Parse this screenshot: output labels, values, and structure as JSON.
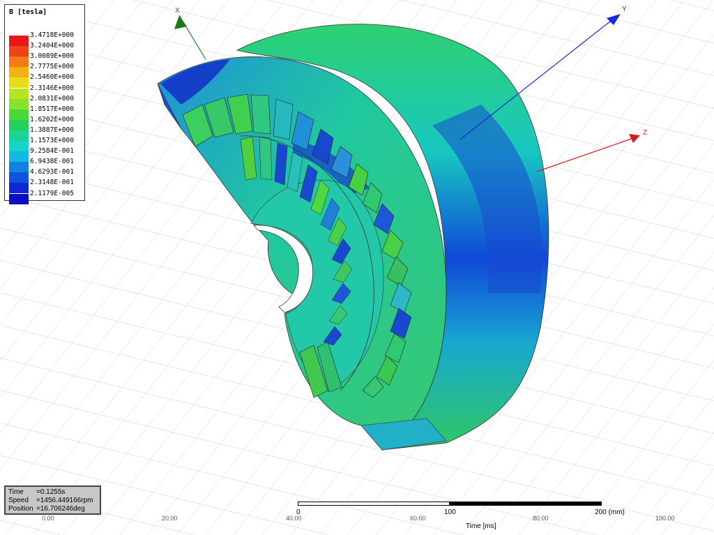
{
  "legend": {
    "title": "B [tesla]",
    "entries": [
      {
        "label": "3.4718E+000",
        "color": "#e4171b"
      },
      {
        "label": "3.2404E+000",
        "color": "#ee4319"
      },
      {
        "label": "3.0089E+000",
        "color": "#f47a13"
      },
      {
        "label": "2.7775E+000",
        "color": "#f6b012"
      },
      {
        "label": "2.5460E+000",
        "color": "#e8de16"
      },
      {
        "label": "2.3146E+000",
        "color": "#b7e421"
      },
      {
        "label": "2.0831E+000",
        "color": "#86e22b"
      },
      {
        "label": "1.8517E+000",
        "color": "#4ad63a"
      },
      {
        "label": "1.6202E+000",
        "color": "#22d05a"
      },
      {
        "label": "1.3887E+000",
        "color": "#19d595"
      },
      {
        "label": "1.1573E+000",
        "color": "#16d6c9"
      },
      {
        "label": "9.2584E-001",
        "color": "#12b9e3"
      },
      {
        "label": "6.9438E-001",
        "color": "#1282e0"
      },
      {
        "label": "4.6293E-001",
        "color": "#1053dc"
      },
      {
        "label": "2.3148E-001",
        "color": "#1026d2"
      },
      {
        "label": "2.1179E-005",
        "color": "#0a0fc0"
      }
    ]
  },
  "status": {
    "time_key": "Time",
    "time_val": "=0.1255s",
    "speed_key": "Speed",
    "speed_val": "=1456.449166rpm",
    "position_key": "Position",
    "position_val": "=16.706246deg"
  },
  "scale": {
    "tick0": "0",
    "tick1": "100",
    "tick2": "200 (mm)"
  },
  "axis_title": "Time [ms]",
  "background_ticks": [
    "0.00",
    "20.00",
    "40.00",
    "60.00",
    "80.00",
    "100.00"
  ],
  "triad": {
    "x": "X",
    "y": "Y",
    "z": "Z",
    "x_color": "#1a7a1a",
    "y_color": "#1a2ad8",
    "z_color": "#d81a1a"
  }
}
